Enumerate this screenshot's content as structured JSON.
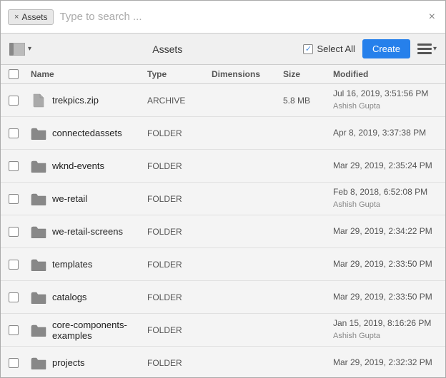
{
  "window": {
    "title": "Assets"
  },
  "search_bar": {
    "tab_label": "Assets",
    "close_tab_icon": "×",
    "search_placeholder": "Type to search ...",
    "close_icon": "×"
  },
  "toolbar": {
    "panel_toggle": "panel-toggle",
    "chevron": "▾",
    "title": "Assets",
    "select_all_label": "Select All",
    "create_label": "Create",
    "list_view_icon": "list-view"
  },
  "columns": {
    "check": "",
    "name": "Name",
    "type": "Type",
    "dimensions": "Dimensions",
    "size": "Size",
    "modified": "Modified"
  },
  "files": [
    {
      "name": "trekpics.zip",
      "type": "ARCHIVE",
      "dimensions": "",
      "size": "5.8 MB",
      "modified": "Jul 16, 2019, 3:51:56 PM",
      "modifier": "Ashish Gupta",
      "icon": "doc"
    },
    {
      "name": "connectedassets",
      "type": "FOLDER",
      "dimensions": "",
      "size": "",
      "modified": "Apr 8, 2019, 3:37:38 PM",
      "modifier": "",
      "icon": "folder"
    },
    {
      "name": "wknd-events",
      "type": "FOLDER",
      "dimensions": "",
      "size": "",
      "modified": "Mar 29, 2019, 2:35:24 PM",
      "modifier": "",
      "icon": "folder"
    },
    {
      "name": "we-retail",
      "type": "FOLDER",
      "dimensions": "",
      "size": "",
      "modified": "Feb 8, 2018, 6:52:08 PM",
      "modifier": "Ashish Gupta",
      "icon": "folder"
    },
    {
      "name": "we-retail-screens",
      "type": "FOLDER",
      "dimensions": "",
      "size": "",
      "modified": "Mar 29, 2019, 2:34:22 PM",
      "modifier": "",
      "icon": "folder"
    },
    {
      "name": "templates",
      "type": "FOLDER",
      "dimensions": "",
      "size": "",
      "modified": "Mar 29, 2019, 2:33:50 PM",
      "modifier": "",
      "icon": "folder"
    },
    {
      "name": "catalogs",
      "type": "FOLDER",
      "dimensions": "",
      "size": "",
      "modified": "Mar 29, 2019, 2:33:50 PM",
      "modifier": "",
      "icon": "folder"
    },
    {
      "name": "core-components-examples",
      "type": "FOLDER",
      "dimensions": "",
      "size": "",
      "modified": "Jan 15, 2019, 8:16:26 PM",
      "modifier": "Ashish Gupta",
      "icon": "folder"
    },
    {
      "name": "projects",
      "type": "FOLDER",
      "dimensions": "",
      "size": "",
      "modified": "Mar 29, 2019, 2:32:32 PM",
      "modifier": "",
      "icon": "folder"
    }
  ]
}
